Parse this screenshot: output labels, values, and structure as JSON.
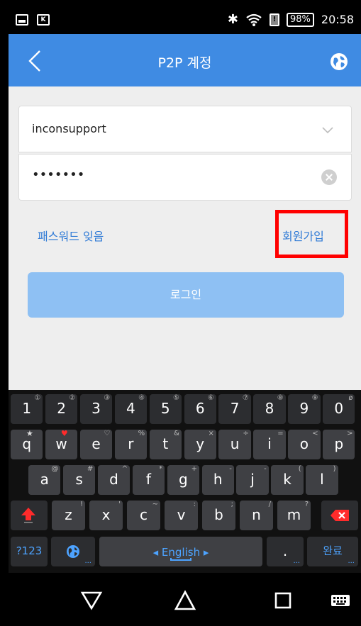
{
  "status_bar": {
    "battery": "98%",
    "time": "20:58",
    "rc_icon_text": "K",
    "sim_icon_text": "!"
  },
  "app_bar": {
    "title": "P2P 계정"
  },
  "login_form": {
    "username_value": "inconsupport",
    "password_value": "•••••••",
    "forgot_password_label": "패스워드 잊음",
    "signup_label": "회원가입",
    "login_button_label": "로그인"
  },
  "keyboard": {
    "number_row": [
      {
        "main": "1",
        "sup": "①"
      },
      {
        "main": "2",
        "sup": "②"
      },
      {
        "main": "3",
        "sup": "③"
      },
      {
        "main": "4",
        "sup": "④"
      },
      {
        "main": "5",
        "sup": "⑤"
      },
      {
        "main": "6",
        "sup": "⑥"
      },
      {
        "main": "7",
        "sup": "⑦"
      },
      {
        "main": "8",
        "sup": "⑧"
      },
      {
        "main": "9",
        "sup": "⑨"
      },
      {
        "main": "0",
        "sup": "ø"
      }
    ],
    "row1": [
      {
        "main": "q",
        "sup": ""
      },
      {
        "main": "w",
        "sup": ""
      },
      {
        "main": "e",
        "sup": "♡"
      },
      {
        "main": "r",
        "sup": "%"
      },
      {
        "main": "t",
        "sup": "&"
      },
      {
        "main": "y",
        "sup": "×"
      },
      {
        "main": "u",
        "sup": "÷"
      },
      {
        "main": "i",
        "sup": "="
      },
      {
        "main": "o",
        "sup": "<"
      },
      {
        "main": "p",
        "sup": ">"
      }
    ],
    "row2": [
      {
        "main": "a",
        "sup": "@"
      },
      {
        "main": "s",
        "sup": "#"
      },
      {
        "main": "d",
        "sup": "^"
      },
      {
        "main": "f",
        "sup": "*"
      },
      {
        "main": "g",
        "sup": "+"
      },
      {
        "main": "h",
        "sup": "-"
      },
      {
        "main": "j",
        "sup": "-"
      },
      {
        "main": "k",
        "sup": "("
      },
      {
        "main": "l",
        "sup": ")"
      }
    ],
    "row3": [
      {
        "main": "z",
        "sup": "!"
      },
      {
        "main": "x",
        "sup": "'"
      },
      {
        "main": "c",
        "sup": "~"
      },
      {
        "main": "v",
        "sup": ":"
      },
      {
        "main": "b",
        "sup": ";"
      },
      {
        "main": "n",
        "sup": "/"
      },
      {
        "main": "m",
        "sup": "?"
      }
    ],
    "mode_label": "?123",
    "space_label": "◂ English ▸",
    "period_label": ".",
    "done_label": "완료",
    "accent_color": "#4da3ff"
  },
  "colors": {
    "app_bar": "#3f8be3",
    "login_button": "#8ec0f3",
    "link": "#2f7ad6",
    "highlight": "#ff0000"
  }
}
